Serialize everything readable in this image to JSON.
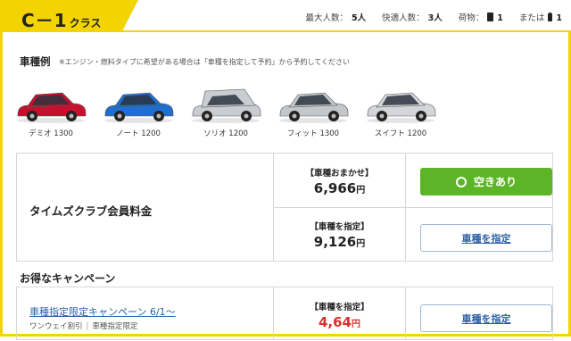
{
  "header": {
    "class_name": "C－1",
    "class_suffix": "クラス",
    "capacity": [
      {
        "label": "最大人数：",
        "value": "5人"
      },
      {
        "label": "快適人数：",
        "value": "3人"
      },
      {
        "label": "荷物：",
        "value": "1"
      },
      {
        "label": "または",
        "value": "1"
      }
    ]
  },
  "cars": {
    "heading": "車種例",
    "note": "※エンジン・燃料タイプに希望がある場合は「車種を指定して予約」から予約してください",
    "items": [
      {
        "label": "デミオ 1300",
        "color": "#c8102e"
      },
      {
        "label": "ノート 1200",
        "color": "#1f6fd1"
      },
      {
        "label": "ソリオ 1200",
        "color": "#c9ccd0"
      },
      {
        "label": "フィット 1300",
        "color": "#c4c7ca"
      },
      {
        "label": "スイフト 1200",
        "color": "#d4d6d9"
      }
    ]
  },
  "pricing": {
    "member_label": "タイムズクラブ会員料金",
    "omakase_label": "【車種おまかせ】",
    "omakase_price": "6,966",
    "yen": "円",
    "available_label": "空きあり",
    "specify_label": "【車種を指定】",
    "specify_price": "9,126",
    "specify_button": "車種を指定"
  },
  "campaign": {
    "section_title": "お得なキャンペーン",
    "link": "車種指定限定キャンペーン 6/1～",
    "tags": [
      "ワンウェイ割引",
      "車種指定限定"
    ],
    "price_label": "【車種を指定】",
    "price": "4,64",
    "yen": "円",
    "button": "車種を指定"
  },
  "colors": {
    "accent_yellow": "#f4d400",
    "available_green": "#5cb526",
    "link_blue": "#2d61a6",
    "sale_red": "#d9302c"
  }
}
